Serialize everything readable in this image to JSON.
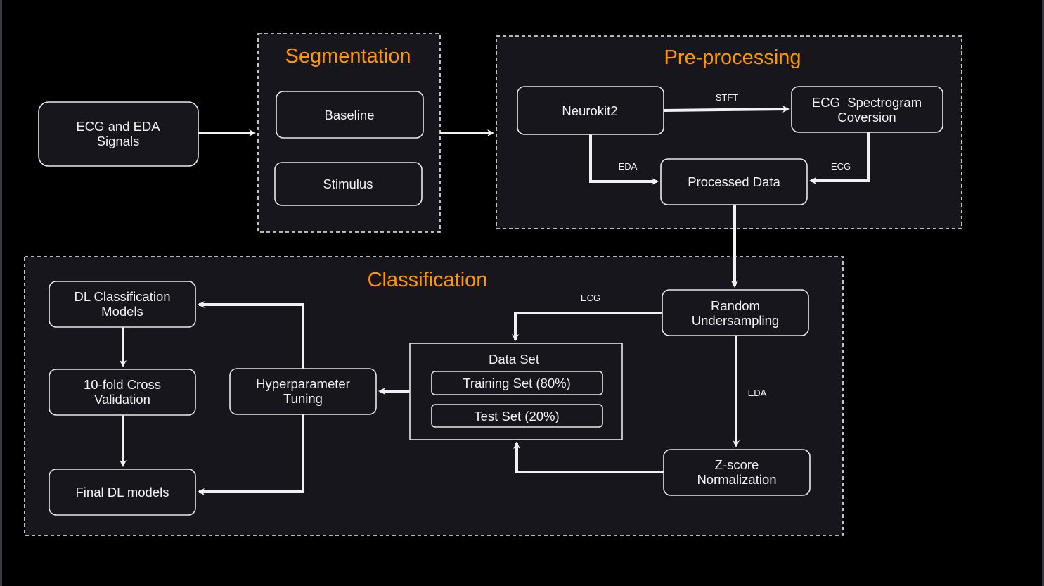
{
  "colors": {
    "background": "#000000",
    "panel": "#18161d",
    "title": "#ff9500",
    "stroke": "#f2f2f2"
  },
  "groups": {
    "segmentation": "Segmentation",
    "preprocessing": "Pre-processing",
    "classification": "Classification"
  },
  "nodes": {
    "signals": [
      "ECG and EDA",
      "Signals"
    ],
    "baseline": "Baseline",
    "stimulus": "Stimulus",
    "neurokit": "Neurokit2",
    "spectrogram": [
      "ECG  Spectrogram",
      "Coversion"
    ],
    "processed": "Processed Data",
    "undersampling": [
      "Random",
      "Undersampling"
    ],
    "zscore": [
      "Z-score",
      "Normalization"
    ],
    "dataset": {
      "title": "Data Set",
      "training": "Training Set (80%)",
      "test": "Test Set (20%)"
    },
    "hyper": [
      "Hyperparameter",
      "Tuning"
    ],
    "dl_models": [
      "DL Classification",
      "Models"
    ],
    "cv": [
      "10-fold Cross",
      "Validation"
    ],
    "final": "Final DL models"
  },
  "edge_labels": {
    "stft": "STFT",
    "eda_pre": "EDA",
    "ecg_pre": "ECG",
    "ecg_cls": "ECG",
    "eda_cls": "EDA"
  }
}
